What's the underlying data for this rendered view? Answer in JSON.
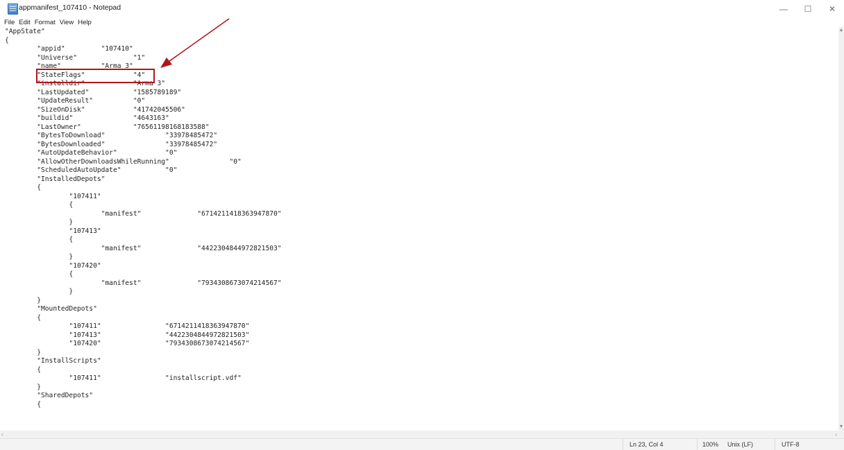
{
  "window": {
    "title": "appmanifest_107410 - Notepad",
    "controls": {
      "minimize": "—",
      "maximize": "☐",
      "close": "✕"
    }
  },
  "menu": [
    "File",
    "Edit",
    "Format",
    "View",
    "Help"
  ],
  "document": {
    "text": "\"AppState\"\n{\n\t\"appid\"\t\t\"107410\"\n\t\"Universe\"\t\t\"1\"\n\t\"name\"\t\t\"Arma 3\"\n\t\"StateFlags\"\t\t\"4\"\n\t\"installdir\"\t\t\"Arma 3\"\n\t\"LastUpdated\"\t\t\"1585789189\"\n\t\"UpdateResult\"\t\t\"0\"\n\t\"SizeOnDisk\"\t\t\"41742045506\"\n\t\"buildid\"\t\t\"4643163\"\n\t\"LastOwner\"\t\t\"76561198168183588\"\n\t\"BytesToDownload\"\t\t\"33978485472\"\n\t\"BytesDownloaded\"\t\t\"33978485472\"\n\t\"AutoUpdateBehavior\"\t\t\"0\"\n\t\"AllowOtherDownloadsWhileRunning\"\t\t\"0\"\n\t\"ScheduledAutoUpdate\"\t\t\"0\"\n\t\"InstalledDepots\"\n\t{\n\t\t\"107411\"\n\t\t{\n\t\t\t\"manifest\"\t\t\"6714211418363947870\"\n\t\t}\n\t\t\"107413\"\n\t\t{\n\t\t\t\"manifest\"\t\t\"4422304844972821503\"\n\t\t}\n\t\t\"107420\"\n\t\t{\n\t\t\t\"manifest\"\t\t\"7934308673074214567\"\n\t\t}\n\t}\n\t\"MountedDepots\"\n\t{\n\t\t\"107411\"\t\t\"6714211418363947870\"\n\t\t\"107413\"\t\t\"4422304844972821503\"\n\t\t\"107420\"\t\t\"7934308673074214567\"\n\t}\n\t\"InstallScripts\"\n\t{\n\t\t\"107411\"\t\t\"installscript.vdf\"\n\t}\n\t\"SharedDepots\"\n\t{"
  },
  "status": {
    "position": "Ln 23, Col 4",
    "zoom": "100%",
    "line_ending": "Unix (LF)",
    "encoding": "UTF-8"
  },
  "annotation": {
    "color": "#b0151b"
  }
}
